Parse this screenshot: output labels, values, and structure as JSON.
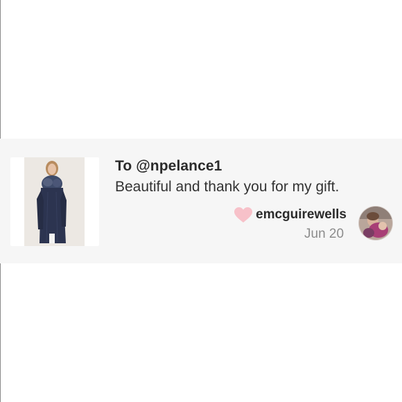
{
  "review": {
    "recipient_line": "To @npelance1",
    "message": "Beautiful and thank you for my gift.",
    "reviewer_username": "emcguirewells",
    "date": "Jun 20",
    "like_icon": "heart-icon",
    "like_color": "#f7c1c9"
  },
  "colors": {
    "card_background": "#f6f6f6",
    "text_primary": "#2b2b2b",
    "text_secondary": "#8c8c8c"
  }
}
